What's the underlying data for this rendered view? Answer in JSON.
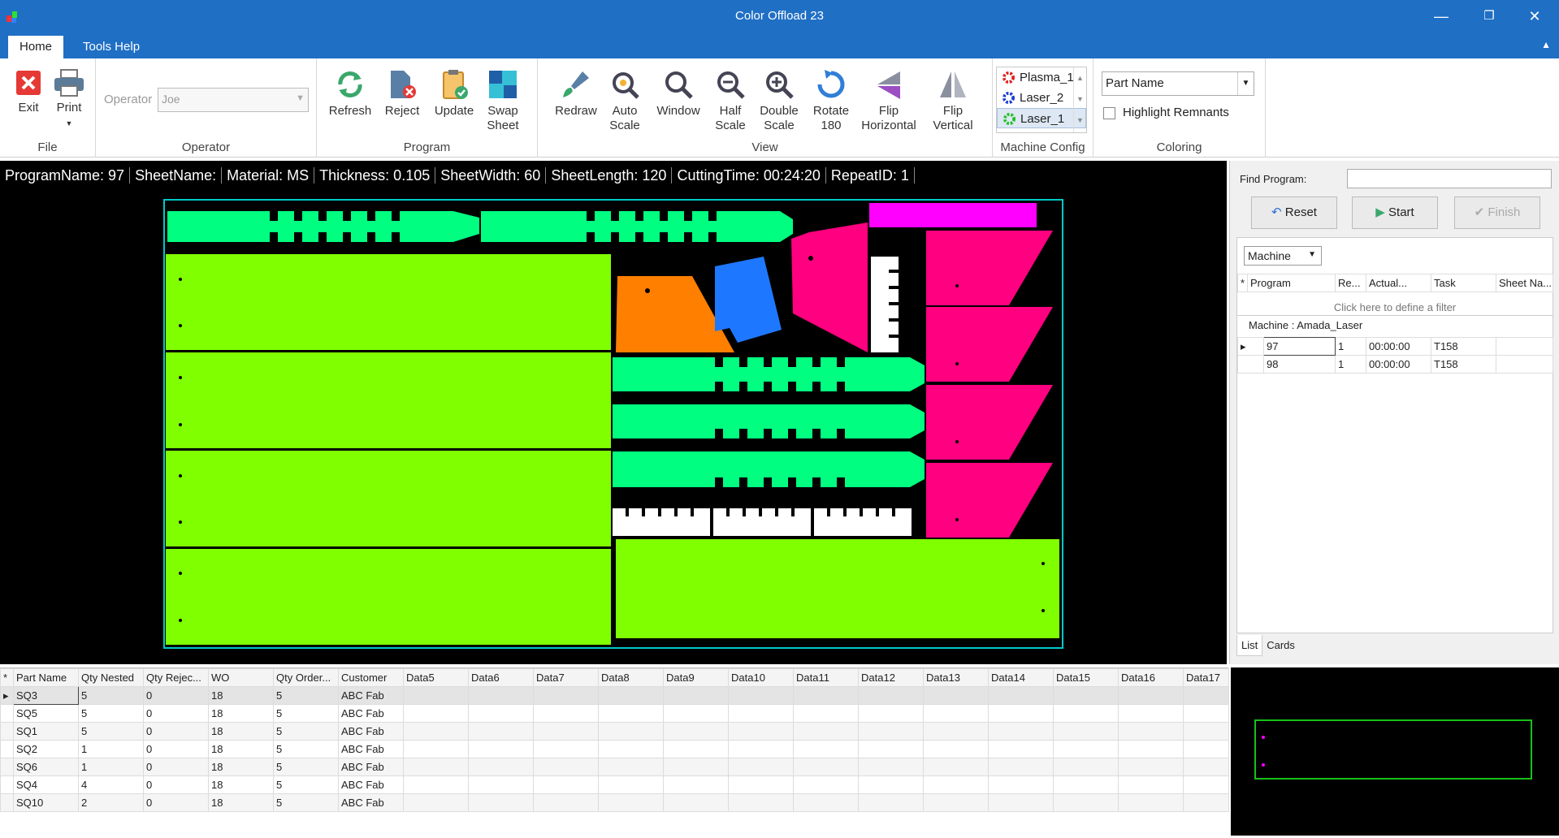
{
  "window": {
    "title": "Color Offload 23",
    "minimize": "—",
    "restore": "❐",
    "close": "✕"
  },
  "tabs": [
    {
      "label": "Home"
    },
    {
      "label": "Tools Help"
    }
  ],
  "ribbon": {
    "file": {
      "label": "File",
      "exit": "Exit",
      "print": "Print"
    },
    "operator": {
      "label": "Operator",
      "field_label": "Operator",
      "value": "Joe"
    },
    "program": {
      "label": "Program",
      "refresh": "Refresh",
      "reject": "Reject",
      "update": "Update",
      "swap1": "Swap",
      "swap2": "Sheet"
    },
    "view": {
      "label": "View",
      "redraw": "Redraw",
      "auto1": "Auto",
      "auto2": "Scale",
      "window": "Window",
      "half1": "Half",
      "half2": "Scale",
      "double1": "Double",
      "double2": "Scale",
      "rotate1": "Rotate",
      "rotate2": "180",
      "fliph1": "Flip",
      "fliph2": "Horizontal",
      "flipv1": "Flip",
      "flipv2": "Vertical"
    },
    "machine_config": {
      "label": "Machine Config",
      "machines": [
        {
          "name": "Plasma_1",
          "color": "#e02020"
        },
        {
          "name": "Laser_2",
          "color": "#1a3fd0"
        },
        {
          "name": "Laser_1",
          "color": "#22c022"
        }
      ]
    },
    "coloring": {
      "label": "Coloring",
      "select": "Part Name",
      "highlight": "Highlight Remnants"
    }
  },
  "info": {
    "program": "ProgramName: 97",
    "sheet": "SheetName:",
    "material": "Material: MS",
    "thickness": "Thickness: 0.105",
    "width": "SheetWidth: 60",
    "length": "SheetLength: 120",
    "cutting": "CuttingTime: 00:24:20",
    "repeat": "RepeatID: 1"
  },
  "colors": {
    "green": "#80ff00",
    "teal": "#00ff80",
    "pink": "#ff0080",
    "orange": "#ff7f00",
    "blue": "#1e78ff",
    "magenta": "#ff00ff",
    "white": "#ffffff",
    "sheet_border": "#00c8c8"
  },
  "right": {
    "find_label": "Find Program:",
    "reset": "Reset",
    "start": "Start",
    "finish": "Finish",
    "machine_select": "Machine",
    "columns": [
      "Program",
      "Re...",
      "Actual...",
      "Task",
      "Sheet Na..."
    ],
    "filter_hint": "Click here to define a filter",
    "group": "Machine : Amada_Laser",
    "rows": [
      [
        "97",
        "1",
        "00:00:00",
        "T158",
        ""
      ],
      [
        "98",
        "1",
        "00:00:00",
        "T158",
        ""
      ]
    ],
    "tab_list": "List",
    "tab_cards": "Cards"
  },
  "parts": {
    "columns": [
      "Part Name",
      "Qty Nested",
      "Qty Rejec...",
      "WO",
      "Qty Order...",
      "Customer",
      "Data5",
      "Data6",
      "Data7",
      "Data8",
      "Data9",
      "Data10",
      "Data11",
      "Data12",
      "Data13",
      "Data14",
      "Data15",
      "Data16",
      "Data17"
    ],
    "rows": [
      [
        "SQ3",
        "5",
        "0",
        "18",
        "5",
        "ABC Fab"
      ],
      [
        "SQ5",
        "5",
        "0",
        "18",
        "5",
        "ABC Fab"
      ],
      [
        "SQ1",
        "5",
        "0",
        "18",
        "5",
        "ABC Fab"
      ],
      [
        "SQ2",
        "1",
        "0",
        "18",
        "5",
        "ABC Fab"
      ],
      [
        "SQ6",
        "1",
        "0",
        "18",
        "5",
        "ABC Fab"
      ],
      [
        "SQ4",
        "4",
        "0",
        "18",
        "5",
        "ABC Fab"
      ],
      [
        "SQ10",
        "2",
        "0",
        "18",
        "5",
        "ABC Fab"
      ]
    ]
  }
}
